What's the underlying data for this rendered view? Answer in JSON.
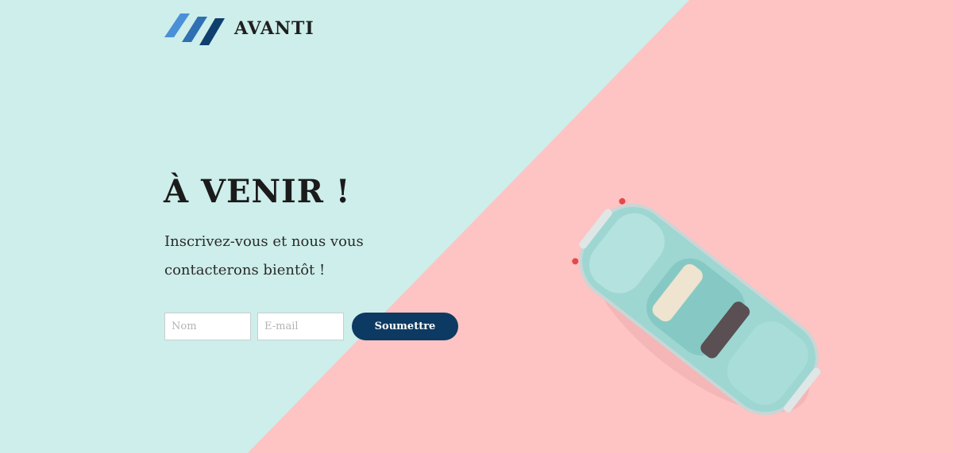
{
  "brand": {
    "name": "AVANTI"
  },
  "hero": {
    "headline": "À VENIR !",
    "subtitle": "Inscrivez-vous et nous vous contacterons bientôt !"
  },
  "form": {
    "name_placeholder": "Nom",
    "email_placeholder": "E-mail",
    "submit_label": "Soumettre"
  },
  "colors": {
    "background_mint": "#cdeeea",
    "background_pink": "#fec3c3",
    "button": "#0d3a63",
    "logo_light": "#4a90d9",
    "logo_dark": "#0f3f6e"
  },
  "decor": {
    "image": "toy-car-illustration"
  }
}
